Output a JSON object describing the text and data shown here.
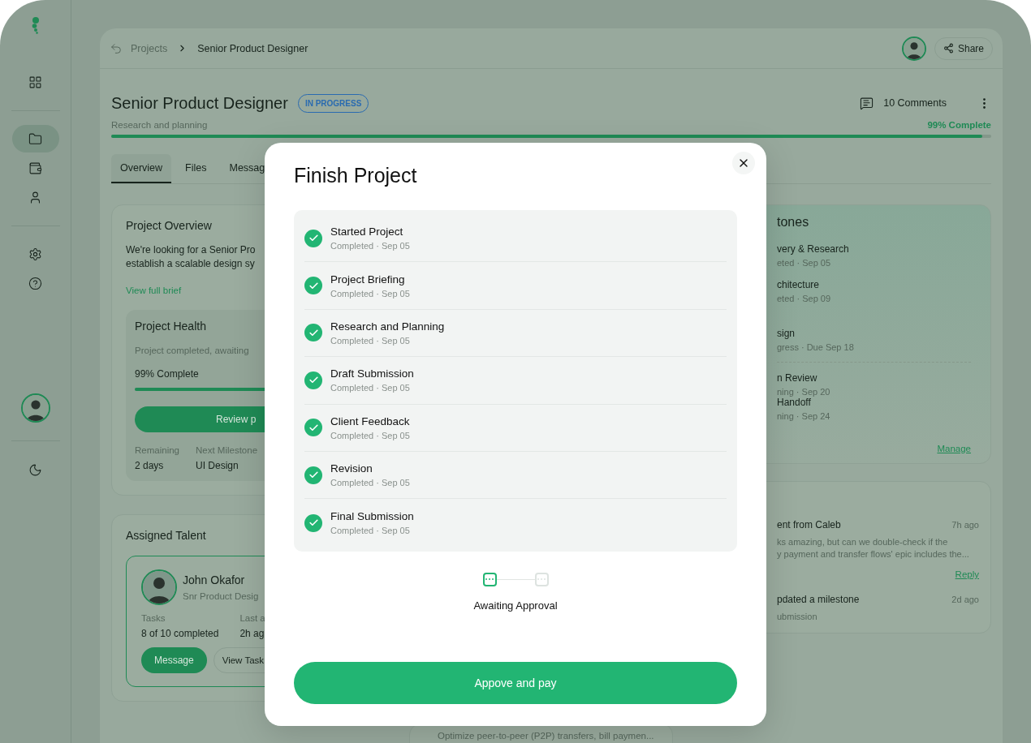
{
  "sidebar": {
    "groups": [
      [
        {
          "selected": false
        }
      ],
      [
        {
          "selected": true
        },
        {
          "selected": false
        },
        {
          "selected": false
        }
      ],
      [
        {
          "selected": false
        },
        {
          "selected": false
        }
      ]
    ]
  },
  "breadcrumb": [
    "Projects",
    "Senior Product Designer"
  ],
  "share": "Share",
  "header": {
    "title": "Senior Product Designer",
    "status": "IN PROGRESS",
    "comments": "10 Comments",
    "phase": "Research and planning",
    "progress_label": "99% Complete",
    "level": 0.99
  },
  "tabs": [
    {
      "label": "Overview",
      "selected": true
    },
    {
      "label": "Files",
      "selected": false
    },
    {
      "label": "Messag",
      "selected": false
    }
  ],
  "overview": {
    "title": "Project Overview",
    "lines": [
      "We're looking for a Senior Pro",
      "establish a scalable design sy"
    ],
    "link": "View full brief",
    "health": {
      "title": "Project Health",
      "note": "Project completed, awaiting",
      "progress_label": "99% Complete",
      "level": 0.99,
      "button": "Review p",
      "stats": [
        {
          "label": "Remaining",
          "value": "2 days"
        },
        {
          "label": "Next Milestone",
          "value": "UI Design"
        }
      ]
    }
  },
  "talent": {
    "title": "Assigned Talent",
    "name": "John Okafor",
    "role": "Snr Product Desig",
    "stats": [
      {
        "label": "Tasks",
        "value": "8 of 10 completed"
      },
      {
        "label": "Last a",
        "value": "2h ag"
      }
    ],
    "buttons": [
      "Message",
      "View Task"
    ]
  },
  "middle_card": {
    "text": "Optimize peer-to-peer (P2P) transfers, bill paymen..."
  },
  "milestones": {
    "title": "tones",
    "items": [
      {
        "title": "very & Research",
        "meta": "eted · Sep 05"
      },
      {
        "title": "chitecture",
        "meta": "eted · Sep 09"
      },
      {
        "title": "sign",
        "meta": "gress · Due Sep 18"
      },
      {
        "title": "n Review",
        "meta": "ning · Sep 20"
      },
      {
        "title": "Handoff",
        "meta": "ning · Sep 24"
      }
    ],
    "link": "Manage"
  },
  "activity": {
    "items": [
      {
        "title": "ent from Caleb",
        "time": "7h ago",
        "lines": [
          "ks amazing, but can we double-check if the",
          "y payment and transfer flows' epic includes the..."
        ],
        "link": "Reply"
      },
      {
        "title": "pdated a milestone",
        "time": "2d ago",
        "lines": [
          "ubmission"
        ]
      }
    ]
  },
  "modal": {
    "title": "Finish Project",
    "steps": [
      {
        "title": "Started Project",
        "meta": "Completed · Sep 05",
        "done": true
      },
      {
        "title": "Project Briefing",
        "meta": "Completed · Sep 05",
        "done": true
      },
      {
        "title": "Research and Planning",
        "meta": "Completed · Sep 05",
        "done": true
      },
      {
        "title": "Draft Submission",
        "meta": "Completed · Sep 05",
        "done": true
      },
      {
        "title": "Client Feedback",
        "meta": "Completed · Sep 05",
        "done": true
      },
      {
        "title": "Revision",
        "meta": "Completed · Sep 05",
        "done": true
      },
      {
        "title": "Final Submission",
        "meta": "Completed · Sep 05",
        "done": true
      }
    ],
    "stages": [
      {
        "active": true
      },
      {
        "active": false
      }
    ],
    "status": "Awaiting Approval",
    "button": "Appove and pay"
  }
}
